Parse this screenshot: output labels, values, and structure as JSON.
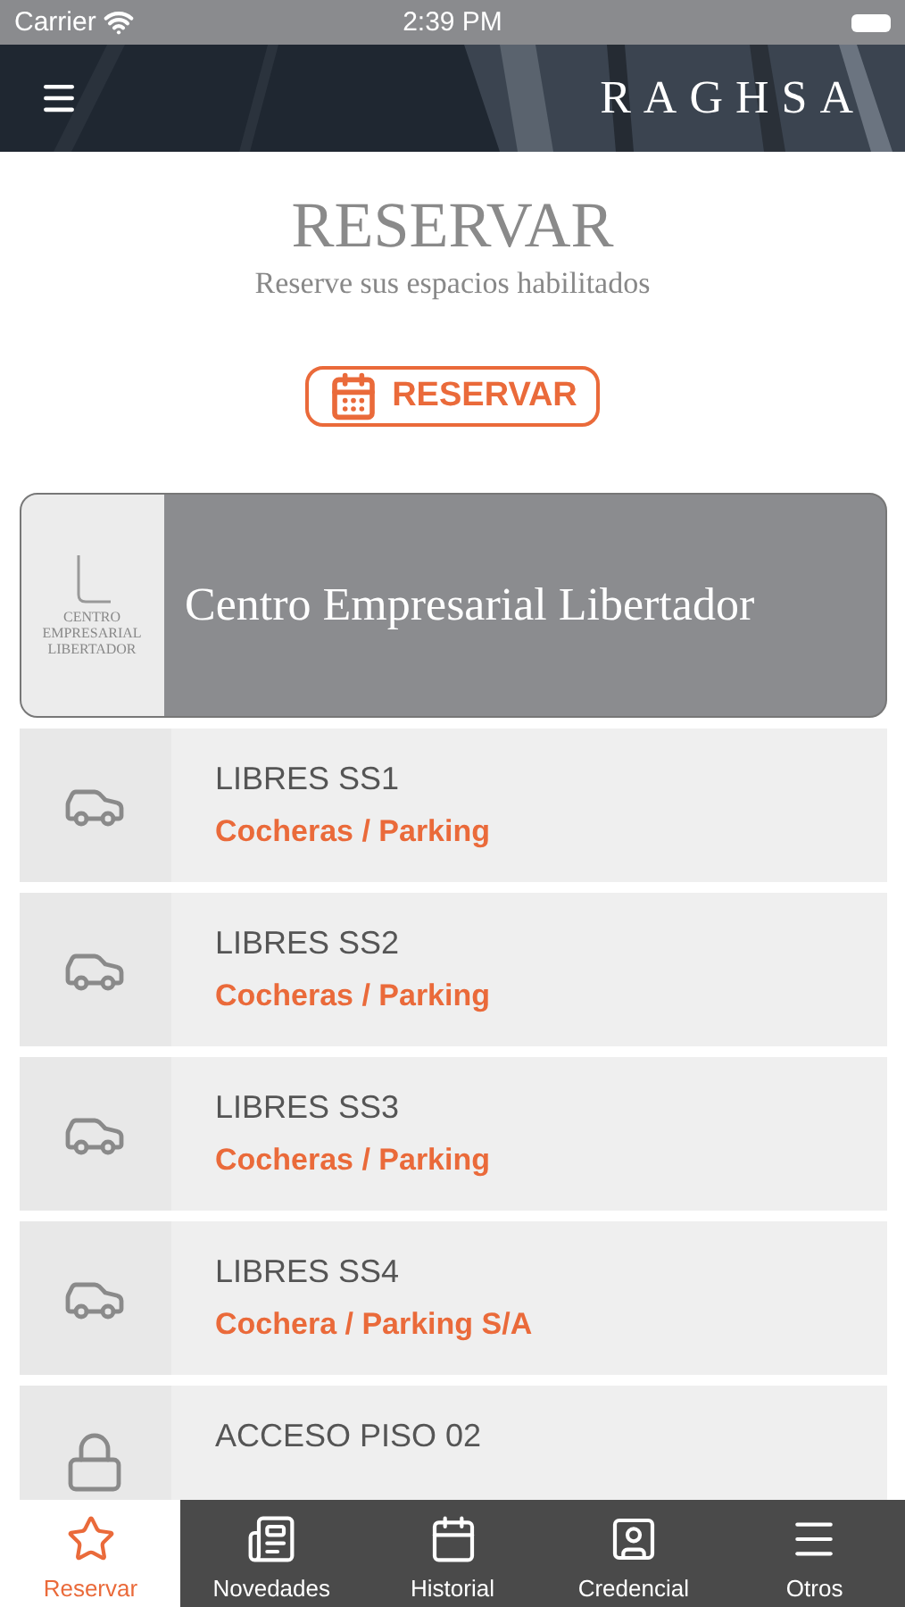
{
  "status_bar": {
    "carrier": "Carrier",
    "time": "2:39 PM"
  },
  "header": {
    "logo": "RAGHSA"
  },
  "page": {
    "title": "RESERVAR",
    "subtitle": "Reserve sus espacios habilitados"
  },
  "reserve_button": {
    "label": "RESERVAR"
  },
  "building": {
    "logo_lines": [
      "CENTRO",
      "EMPRESARIAL",
      "LIBERTADOR"
    ],
    "name": "Centro Empresarial Libertador"
  },
  "spaces": [
    {
      "kind": "parking",
      "title": "LIBRES SS1",
      "subtitle": "Cocheras / Parking"
    },
    {
      "kind": "parking",
      "title": "LIBRES SS2",
      "subtitle": "Cocheras / Parking"
    },
    {
      "kind": "parking",
      "title": "LIBRES SS3",
      "subtitle": "Cocheras / Parking"
    },
    {
      "kind": "parking",
      "title": "LIBRES SS4",
      "subtitle": "Cochera / Parking S/A"
    },
    {
      "kind": "access",
      "title": "ACCESO PISO 02"
    }
  ],
  "tab_bar": [
    {
      "kind": "star",
      "label": "Reservar",
      "selected": true
    },
    {
      "kind": "news",
      "label": "Novedades",
      "selected": false
    },
    {
      "kind": "calendar",
      "label": "Historial",
      "selected": false
    },
    {
      "kind": "badge",
      "label": "Credencial",
      "selected": false
    },
    {
      "kind": "menu",
      "label": "Otros",
      "selected": false
    }
  ]
}
